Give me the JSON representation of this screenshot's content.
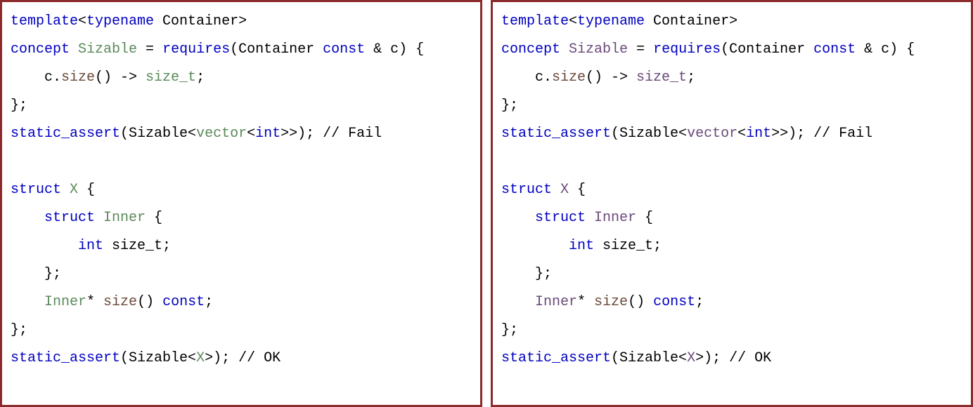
{
  "left": {
    "l1_template": "template",
    "l1_lt": "<",
    "l1_typename": "typename",
    "l1_container": " Container",
    "l1_gt": ">",
    "l2_concept": "concept",
    "l2_sizable": " Sizable ",
    "l2_eq": "= ",
    "l2_requires": "requires",
    "l2_open": "(Container ",
    "l2_const": "const",
    "l2_rest": " & c) {",
    "l3_indent": "    c.",
    "l3_size": "size",
    "l3_paren": "() -> ",
    "l3_sizet": "size_t",
    "l3_semi": ";",
    "l4": "};",
    "l5_sa": "static_assert",
    "l5_open": "(Sizable<",
    "l5_vector": "vector",
    "l5_lt": "<",
    "l5_int": "int",
    "l5_gt": ">>); ",
    "l5_comment": "// Fail",
    "l6": "",
    "l7_struct": "struct",
    "l7_X": " X ",
    "l7_brace": "{",
    "l8_indent": "    ",
    "l8_struct": "struct",
    "l8_inner": " Inner ",
    "l8_brace": "{",
    "l9_indent": "        ",
    "l9_int": "int",
    "l9_sizet": " size_t;",
    "l10": "    };",
    "l11_indent": "    ",
    "l11_inner": "Inner",
    "l11_star": "* ",
    "l11_size": "size",
    "l11_paren": "() ",
    "l11_const": "const",
    "l11_semi": ";",
    "l12": "};",
    "l13_sa": "static_assert",
    "l13_open": "(Sizable<",
    "l13_X": "X",
    "l13_close": ">); ",
    "l13_comment": "// OK"
  },
  "right": {
    "l1_template": "template",
    "l1_lt": "<",
    "l1_typename": "typename",
    "l1_container": " Container",
    "l1_gt": ">",
    "l2_concept": "concept",
    "l2_sizable": " Sizable ",
    "l2_eq": "= ",
    "l2_requires": "requires",
    "l2_open": "(Container ",
    "l2_const": "const",
    "l2_rest": " & c) {",
    "l3_indent": "    c.",
    "l3_size": "size",
    "l3_paren": "() -> ",
    "l3_sizet": "size_t",
    "l3_semi": ";",
    "l4": "};",
    "l5_sa": "static_assert",
    "l5_open": "(Sizable<",
    "l5_vector": "vector",
    "l5_lt": "<",
    "l5_int": "int",
    "l5_gt": ">>); ",
    "l5_comment": "// Fail",
    "l6": "",
    "l7_struct": "struct",
    "l7_X": " X ",
    "l7_brace": "{",
    "l8_indent": "    ",
    "l8_struct": "struct",
    "l8_inner": " Inner ",
    "l8_brace": "{",
    "l9_indent": "        ",
    "l9_int": "int",
    "l9_sizet": " size_t;",
    "l10": "    };",
    "l11_indent": "    ",
    "l11_inner": "Inner",
    "l11_star": "* ",
    "l11_size": "size",
    "l11_paren": "() ",
    "l11_const": "const",
    "l11_semi": ";",
    "l12": "};",
    "l13_sa": "static_assert",
    "l13_open": "(Sizable<",
    "l13_X": "X",
    "l13_close": ">); ",
    "l13_comment": "// OK"
  }
}
